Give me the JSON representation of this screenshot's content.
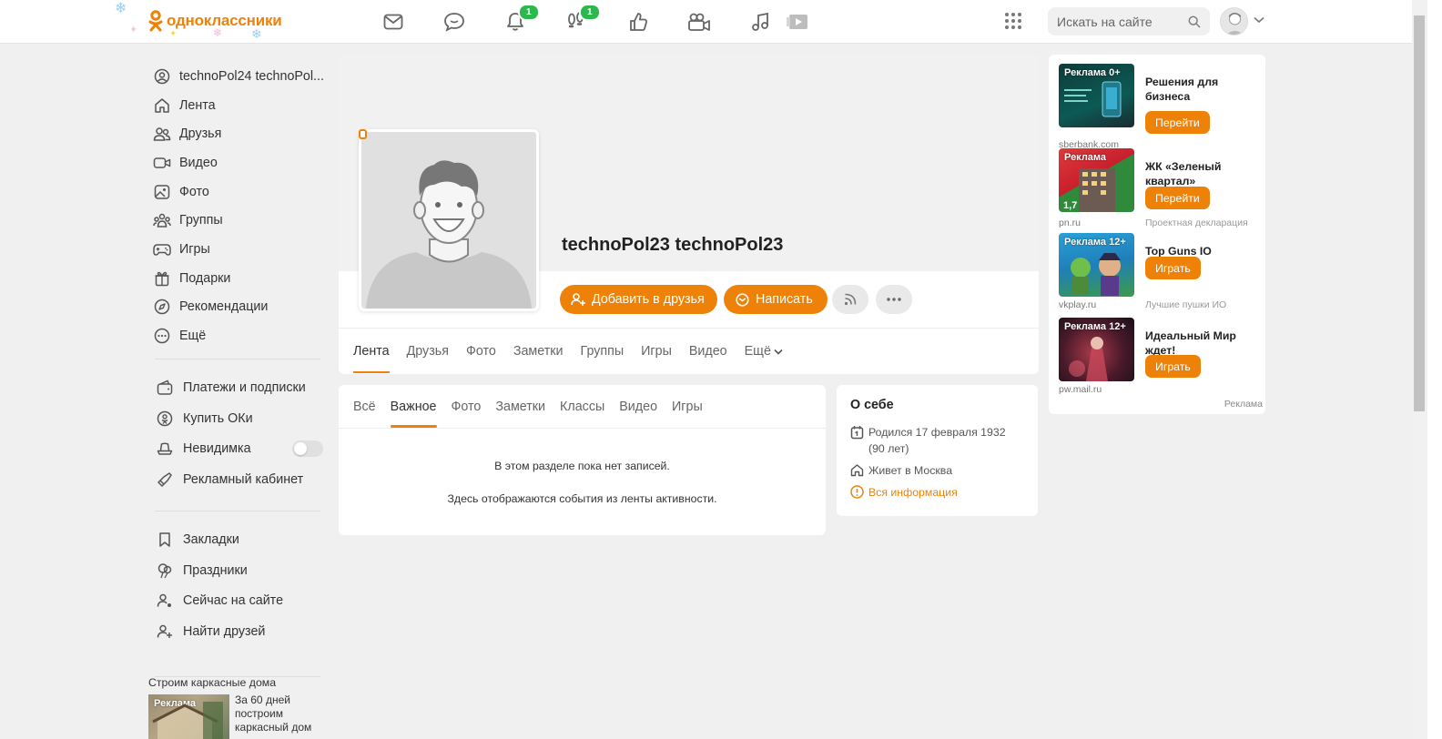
{
  "brand": {
    "name": "одноклассники",
    "accent": "#ee8208",
    "badge_color": "#2bb84d"
  },
  "topnav": {
    "items": [
      {
        "name": "messages-icon",
        "badge": ""
      },
      {
        "name": "discussions-icon",
        "badge": ""
      },
      {
        "name": "notifications-icon",
        "badge": "1"
      },
      {
        "name": "guests-icon",
        "badge": "1"
      },
      {
        "name": "events-icon",
        "badge": ""
      },
      {
        "name": "video-icon",
        "badge": ""
      },
      {
        "name": "music-icon",
        "badge": ""
      }
    ],
    "search_placeholder": "Искать на сайте"
  },
  "sidebar": {
    "items": [
      {
        "label": "technoPol24 technoPol...",
        "icon": "user-icon"
      },
      {
        "label": "Лента",
        "icon": "home-icon"
      },
      {
        "label": "Друзья",
        "icon": "friends-icon"
      },
      {
        "label": "Видео",
        "icon": "video-icon"
      },
      {
        "label": "Фото",
        "icon": "photo-icon"
      },
      {
        "label": "Группы",
        "icon": "groups-icon"
      },
      {
        "label": "Игры",
        "icon": "gamepad-icon"
      },
      {
        "label": "Подарки",
        "icon": "gift-icon"
      },
      {
        "label": "Рекомендации",
        "icon": "compass-icon"
      },
      {
        "label": "Ещё",
        "icon": "more-icon"
      }
    ],
    "items2": [
      {
        "label": "Платежи и подписки",
        "icon": "wallet-icon"
      },
      {
        "label": "Купить ОКи",
        "icon": "ok-coin-icon"
      },
      {
        "label": "Невидимка",
        "icon": "invisible-icon",
        "toggle": false
      },
      {
        "label": "Рекламный кабинет",
        "icon": "megaphone-icon"
      }
    ],
    "items3": [
      {
        "label": "Закладки",
        "icon": "bookmark-icon"
      },
      {
        "label": "Праздники",
        "icon": "balloons-icon"
      },
      {
        "label": "Сейчас на сайте",
        "icon": "online-users-icon"
      },
      {
        "label": "Найти друзей",
        "icon": "add-friend-icon"
      }
    ],
    "ad": {
      "title": "Строим каркасные дома",
      "tag": "Реклама",
      "text": "За 60 дней построим каркасный дом"
    }
  },
  "profile": {
    "name": "technoPol23 technoPol23",
    "add_friend_label": "Добавить в друзья",
    "write_label": "Написать",
    "tabs": [
      "Лента",
      "Друзья",
      "Фото",
      "Заметки",
      "Группы",
      "Игры",
      "Видео",
      "Ещё"
    ],
    "active_tab": "Лента"
  },
  "feed": {
    "tabs": [
      "Всё",
      "Важное",
      "Фото",
      "Заметки",
      "Классы",
      "Видео",
      "Игры"
    ],
    "active_tab": "Важное",
    "empty_line1": "В этом разделе пока нет записей.",
    "empty_line2": "Здесь отображаются события из ленты активности."
  },
  "about": {
    "title": "О себе",
    "born": "Родился 17 февраля 1932 (90 лет)",
    "lives": "Живет в Москва",
    "all_info": "Вся информация"
  },
  "ads": {
    "items": [
      {
        "tag": "Реклама 0+",
        "title": "Решения для бизнеса",
        "button": "Перейти",
        "domain": "sberbank.com",
        "sub": ""
      },
      {
        "tag": "Реклама",
        "title": "ЖК «Зеленый квартал»",
        "button": "Перейти",
        "domain": "pn.ru",
        "sub": "Проектная декларация н"
      },
      {
        "tag": "Реклама 12+",
        "title": "Top Guns IO",
        "button": "Играть",
        "domain": "vkplay.ru",
        "sub": "Лучшие пушки ИО"
      },
      {
        "tag": "Реклама 12+",
        "title": "Идеальный Мир ждет!",
        "button": "Играть",
        "domain": "pw.mail.ru",
        "sub": ""
      }
    ],
    "footer_label": "Реклама"
  }
}
